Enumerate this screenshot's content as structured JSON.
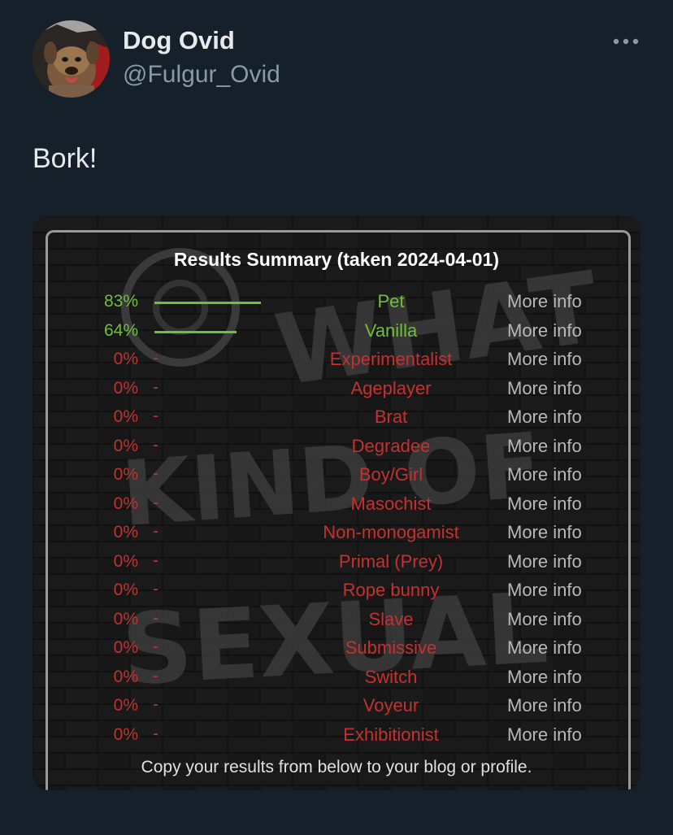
{
  "author": {
    "display_name": "Dog Ovid",
    "handle": "@Fulgur_Ovid"
  },
  "more_button_icon": "more-horizontal-icon",
  "tweet_text": "Bork!",
  "media": {
    "title": "Results Summary (taken 2024-04-01)",
    "rows": [
      {
        "percent": "83%",
        "value": 0.83,
        "label": "Pet",
        "more": "More info",
        "status": "positive"
      },
      {
        "percent": "64%",
        "value": 0.64,
        "label": "Vanilla",
        "more": "More info",
        "status": "positive"
      },
      {
        "percent": "0%",
        "value": 0,
        "label": "Experimentalist",
        "more": "More info",
        "status": "zero"
      },
      {
        "percent": "0%",
        "value": 0,
        "label": "Ageplayer",
        "more": "More info",
        "status": "zero"
      },
      {
        "percent": "0%",
        "value": 0,
        "label": "Brat",
        "more": "More info",
        "status": "zero"
      },
      {
        "percent": "0%",
        "value": 0,
        "label": "Degradee",
        "more": "More info",
        "status": "zero"
      },
      {
        "percent": "0%",
        "value": 0,
        "label": "Boy/Girl",
        "more": "More info",
        "status": "zero"
      },
      {
        "percent": "0%",
        "value": 0,
        "label": "Masochist",
        "more": "More info",
        "status": "zero"
      },
      {
        "percent": "0%",
        "value": 0,
        "label": "Non-monogamist",
        "more": "More info",
        "status": "zero"
      },
      {
        "percent": "0%",
        "value": 0,
        "label": "Primal (Prey)",
        "more": "More info",
        "status": "zero"
      },
      {
        "percent": "0%",
        "value": 0,
        "label": "Rope bunny",
        "more": "More info",
        "status": "zero"
      },
      {
        "percent": "0%",
        "value": 0,
        "label": "Slave",
        "more": "More info",
        "status": "zero"
      },
      {
        "percent": "0%",
        "value": 0,
        "label": "Submissive",
        "more": "More info",
        "status": "zero"
      },
      {
        "percent": "0%",
        "value": 0,
        "label": "Switch",
        "more": "More info",
        "status": "zero"
      },
      {
        "percent": "0%",
        "value": 0,
        "label": "Voyeur",
        "more": "More info",
        "status": "zero"
      },
      {
        "percent": "0%",
        "value": 0,
        "label": "Exhibitionist",
        "more": "More info",
        "status": "zero"
      }
    ],
    "zero_marker": "-",
    "footer": "Copy your results from below to your blog or profile.",
    "background_text": [
      "WHAT",
      "KIND OF",
      "SEXUAL"
    ]
  },
  "colors": {
    "background": "#15202b",
    "positive": "#6fbf3a",
    "zero": "#c4312f",
    "more_info": "#b8b8b8"
  }
}
